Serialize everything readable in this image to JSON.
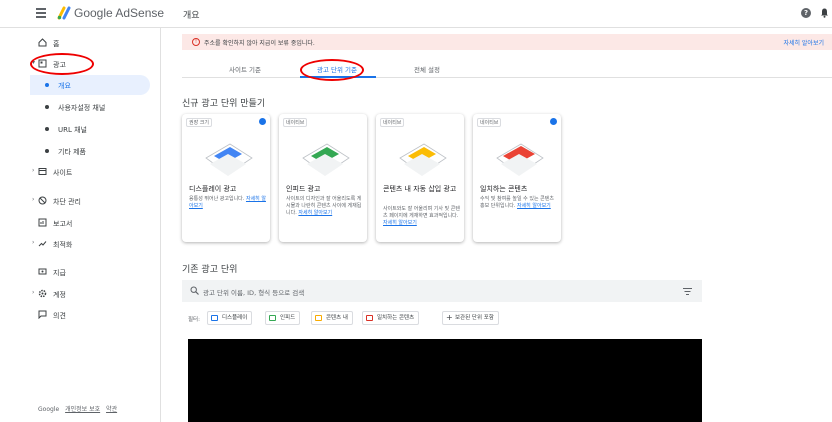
{
  "header": {
    "brand": "Google AdSense",
    "page_title": "개요"
  },
  "sidebar": {
    "items": [
      {
        "label": "홈",
        "icon": "home-icon"
      },
      {
        "label": "광고",
        "icon": "ads-icon"
      },
      {
        "label": "개요"
      },
      {
        "label": "사용자설정 채널"
      },
      {
        "label": "URL 채널"
      },
      {
        "label": "기타 제품"
      },
      {
        "label": "사이트",
        "icon": "site-icon"
      },
      {
        "label": "차단 관리",
        "icon": "block-icon"
      },
      {
        "label": "보고서",
        "icon": "report-icon"
      },
      {
        "label": "최적화",
        "icon": "optimize-icon"
      },
      {
        "label": "지급",
        "icon": "payment-icon"
      },
      {
        "label": "계정",
        "icon": "settings-icon"
      },
      {
        "label": "의견",
        "icon": "feedback-icon"
      }
    ],
    "footer": {
      "google": "Google",
      "privacy": "개인정보 보호",
      "terms": "약관"
    }
  },
  "alert": {
    "text": "주소를 확인하지 않아 지급이 보류 중입니다.",
    "link": "자세히 알아보기"
  },
  "tabs": [
    {
      "label": "사이트 기준"
    },
    {
      "label": "광고 단위 기준"
    },
    {
      "label": "전체 설정"
    }
  ],
  "new_ad_unit": {
    "title": "신규 광고 단위 만들기",
    "cards": [
      {
        "tag": "권장 크기",
        "title": "디스플레이 광고",
        "desc": "융통성 뛰어난 광고입니다.",
        "link": "자세히 알아보기",
        "color": "#4285f4"
      },
      {
        "tag": "네이티브",
        "title": "인피드 광고",
        "desc": "사이트의 디자인과 잘 어울리도록 게시물과 나란히 콘텐츠 사이에 게재됩니다.",
        "link": "자세히 알아보기",
        "color": "#34a853"
      },
      {
        "tag": "네이티브",
        "title": "콘텐츠 내 자동 삽입 광고",
        "desc": "사이트와도 잘 어울리며 기사 및 콘텐츠 페이지에 게재하면 효과적입니다.",
        "link": "자세히 알아보기",
        "color": "#fbbc04"
      },
      {
        "tag": "네이티브",
        "title": "일치하는 콘텐츠",
        "desc": "수익 및 참여를 높일 수 있는 콘텐츠 홍보 단위입니다.",
        "link": "자세히 알아보기",
        "color": "#ea4335"
      }
    ]
  },
  "existing": {
    "title": "기존 광고 단위",
    "search_placeholder": "광고 단위 이름, ID, 형식 등으로 검색",
    "filter_label": "필터:",
    "filters": [
      {
        "label": "디스플레이",
        "color": "#1a73e8"
      },
      {
        "label": "인피드",
        "color": "#34a853"
      },
      {
        "label": "콘텐츠 내",
        "color": "#f9ab00"
      },
      {
        "label": "일치하는 콘텐츠",
        "color": "#d93025"
      },
      {
        "label": "보관된 단위 포함",
        "color": "#5f6368"
      }
    ]
  }
}
